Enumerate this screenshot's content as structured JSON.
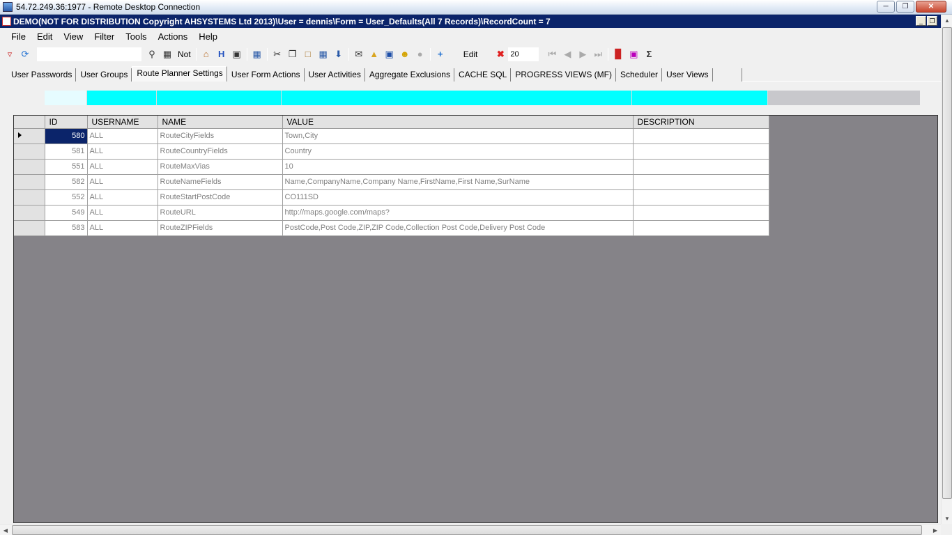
{
  "rdp": {
    "title": "54.72.249.36:1977 - Remote Desktop Connection"
  },
  "app": {
    "title": "DEMO(NOT FOR DISTRIBUTION Copyright AHSYSTEMS Ltd 2013)\\User = dennis\\Form = User_Defaults(All 7 Records)\\RecordCount = 7"
  },
  "menu": [
    "File",
    "Edit",
    "View",
    "Filter",
    "Tools",
    "Actions",
    "Help"
  ],
  "toolbar": {
    "search_value": "",
    "not_label": "Not",
    "h_label": "H",
    "edit_label": "Edit",
    "page_size": "20"
  },
  "tabs": [
    {
      "label": "User Passwords"
    },
    {
      "label": "User Groups"
    },
    {
      "label": "Route Planner Settings",
      "active": true
    },
    {
      "label": "User Form Actions"
    },
    {
      "label": "User Activities"
    },
    {
      "label": "Aggregate Exclusions"
    },
    {
      "label": "CACHE SQL"
    },
    {
      "label": "PROGRESS VIEWS (MF)"
    },
    {
      "label": "Scheduler"
    },
    {
      "label": "User Views"
    }
  ],
  "grid": {
    "columns": [
      "ID",
      "USERNAME",
      "NAME",
      "VALUE",
      "DESCRIPTION"
    ],
    "rows": [
      {
        "id": "580",
        "username": "ALL",
        "name": "RouteCityFields",
        "value": "Town,City",
        "description": ""
      },
      {
        "id": "581",
        "username": "ALL",
        "name": "RouteCountryFields",
        "value": "Country",
        "description": ""
      },
      {
        "id": "551",
        "username": "ALL",
        "name": "RouteMaxVias",
        "value": "10",
        "description": ""
      },
      {
        "id": "582",
        "username": "ALL",
        "name": "RouteNameFields",
        "value": "Name,CompanyName,Company Name,FirstName,First Name,SurName",
        "description": ""
      },
      {
        "id": "552",
        "username": "ALL",
        "name": "RouteStartPostCode",
        "value": "CO111SD",
        "description": ""
      },
      {
        "id": "549",
        "username": "ALL",
        "name": "RouteURL",
        "value": "http://maps.google.com/maps?",
        "description": ""
      },
      {
        "id": "583",
        "username": "ALL",
        "name": "RouteZIPFields",
        "value": "PostCode,Post Code,ZIP,ZIP Code,Collection Post Code,Delivery Post Code",
        "description": ""
      }
    ]
  },
  "colors": {
    "filter_cyan": "#00ffff",
    "selection": "#0b246a",
    "grid_background": "#858388"
  }
}
